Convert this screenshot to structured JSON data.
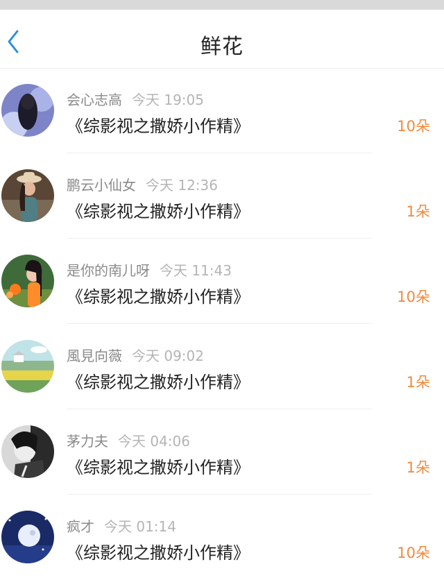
{
  "header": {
    "title": "鲜花",
    "back_icon": "chevron-left-icon",
    "accent_color": "#2a8fe0"
  },
  "list": {
    "count_color": "#f08a3c",
    "items": [
      {
        "name": "会心志高",
        "time": "今天 19:05",
        "book": "《综影视之撒娇小作精》",
        "count": "10朵"
      },
      {
        "name": "鹏云小仙女",
        "time": "今天 12:36",
        "book": "《综影视之撒娇小作精》",
        "count": "1朵"
      },
      {
        "name": "是你的南儿呀",
        "time": "今天 11:43",
        "book": "《综影视之撒娇小作精》",
        "count": "10朵"
      },
      {
        "name": "風見向薇",
        "time": "今天 09:02",
        "book": "《综影视之撒娇小作精》",
        "count": "1朵"
      },
      {
        "name": "茅力夫",
        "time": "今天 04:06",
        "book": "《综影视之撒娇小作精》",
        "count": "1朵"
      },
      {
        "name": "疯才",
        "time": "今天 01:14",
        "book": "《综影视之撒娇小作精》",
        "count": "10朵"
      }
    ]
  }
}
